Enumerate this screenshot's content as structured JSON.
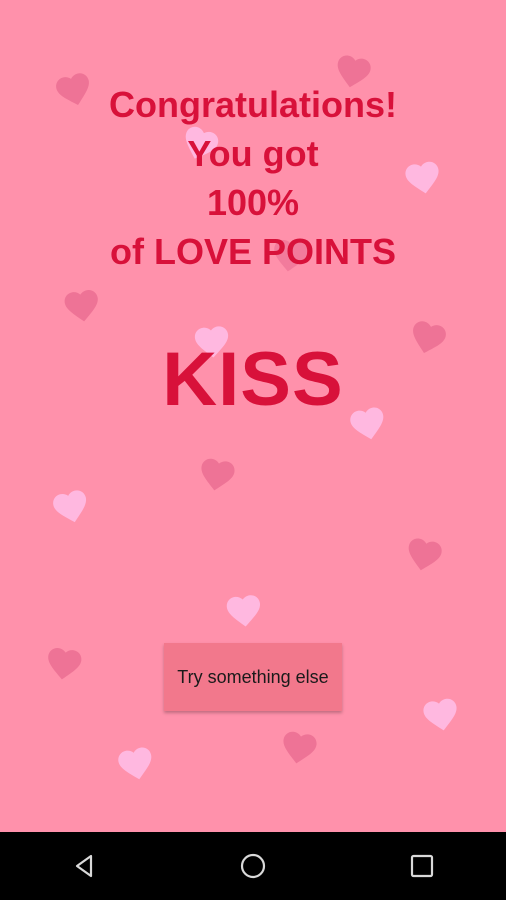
{
  "colors": {
    "background": "#ff91ab",
    "heading_text": "#d8113a",
    "button_bg": "#f2788c",
    "heart_dark": "#e8698f",
    "heart_light": "#ffbce5",
    "navbar": "#000000"
  },
  "message": {
    "line1": "Congratulations!",
    "line2": "You got",
    "line3": "100%",
    "line4": "of LOVE POINTS"
  },
  "result": {
    "word": "KISS"
  },
  "actions": {
    "try_again_label": "Try something else"
  },
  "navbar": {
    "back_icon": "back-triangle-icon",
    "home_icon": "home-circle-icon",
    "recents_icon": "recents-square-icon"
  }
}
